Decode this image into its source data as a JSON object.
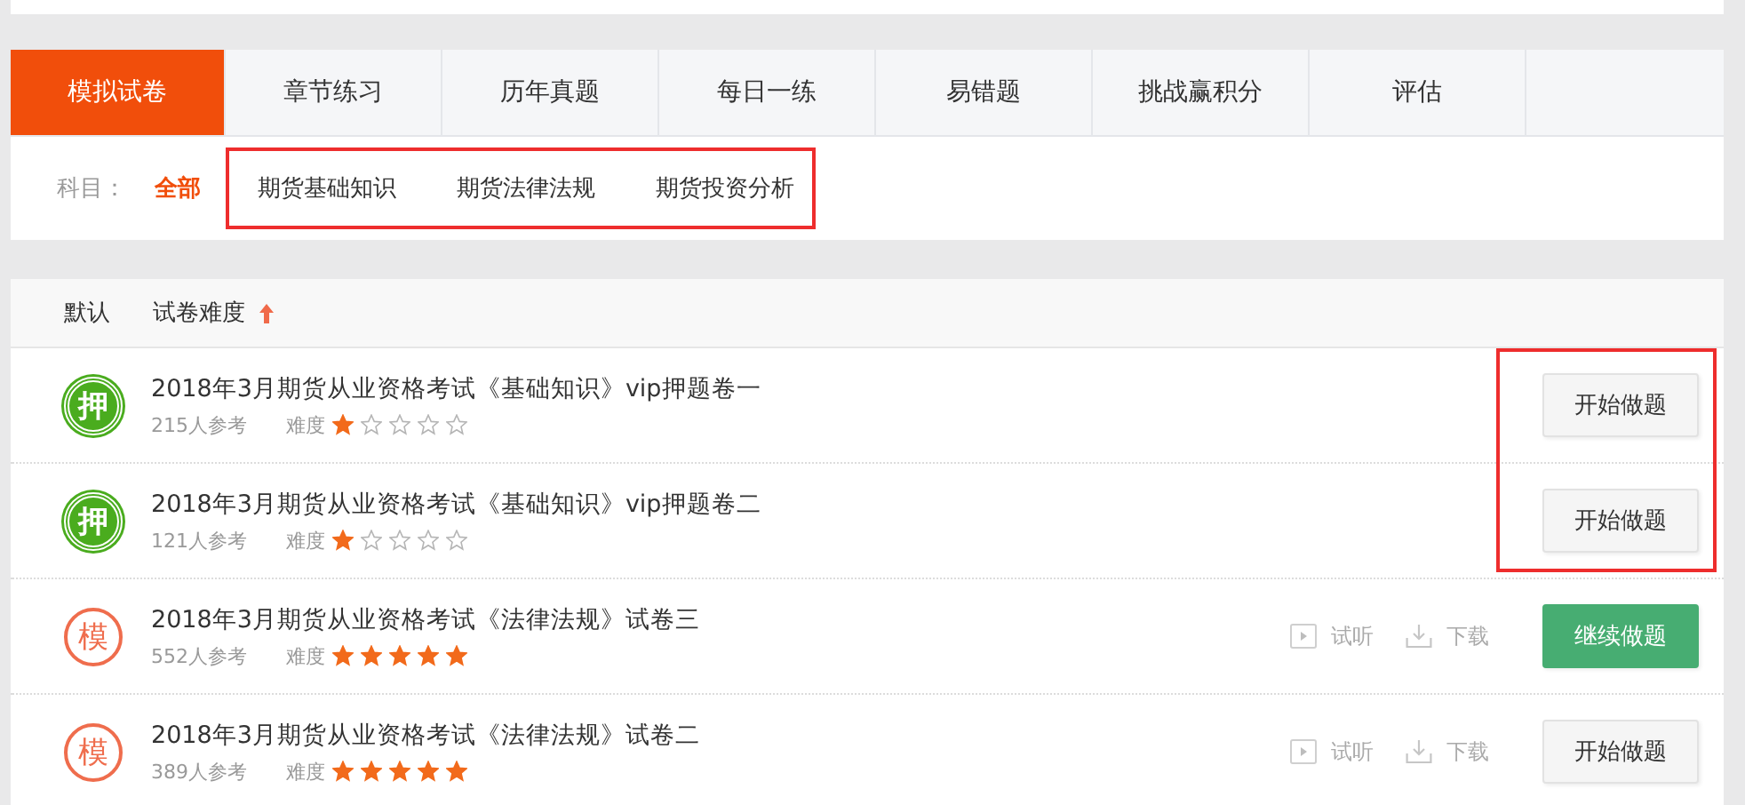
{
  "tabs": [
    {
      "label": "模拟试卷",
      "selected": true
    },
    {
      "label": "章节练习",
      "selected": false
    },
    {
      "label": "历年真题",
      "selected": false
    },
    {
      "label": "每日一练",
      "selected": false
    },
    {
      "label": "易错题",
      "selected": false
    },
    {
      "label": "挑战赢积分",
      "selected": false
    },
    {
      "label": "评估",
      "selected": false
    }
  ],
  "subject_filter": {
    "label": "科目：",
    "options": [
      {
        "label": "全部",
        "selected": true
      },
      {
        "label": "期货基础知识",
        "selected": false
      },
      {
        "label": "期货法律法规",
        "selected": false
      },
      {
        "label": "期货投资分析",
        "selected": false
      }
    ]
  },
  "sort_bar": [
    {
      "label": "默认",
      "arrow": false
    },
    {
      "label": "试卷难度",
      "arrow": true
    }
  ],
  "papers": [
    {
      "badge": "押",
      "kind": "vip",
      "title": "2018年3月期货从业资格考试《基础知识》vip押题卷一",
      "participants": "215人参考",
      "difficulty_label": "难度",
      "stars": 1,
      "button": {
        "label": "开始做题",
        "kind": "default"
      }
    },
    {
      "badge": "押",
      "kind": "vip",
      "title": "2018年3月期货从业资格考试《基础知识》vip押题卷二",
      "participants": "121人参考",
      "difficulty_label": "难度",
      "stars": 1,
      "button": {
        "label": "开始做题",
        "kind": "default"
      }
    },
    {
      "badge": "模",
      "kind": "mock",
      "title": "2018年3月期货从业资格考试《法律法规》试卷三",
      "participants": "552人参考",
      "difficulty_label": "难度",
      "stars": 5,
      "actions": [
        {
          "label": "试听",
          "kind": "play"
        },
        {
          "label": "下载",
          "kind": "download"
        }
      ],
      "button": {
        "label": "继续做题",
        "kind": "primary"
      }
    },
    {
      "badge": "模",
      "kind": "mock",
      "title": "2018年3月期货从业资格考试《法律法规》试卷二",
      "participants": "389人参考",
      "difficulty_label": "难度",
      "stars": 5,
      "actions": [
        {
          "label": "试听",
          "kind": "play"
        },
        {
          "label": "下载",
          "kind": "download"
        }
      ],
      "button": {
        "label": "开始做题",
        "kind": "default"
      }
    }
  ]
}
